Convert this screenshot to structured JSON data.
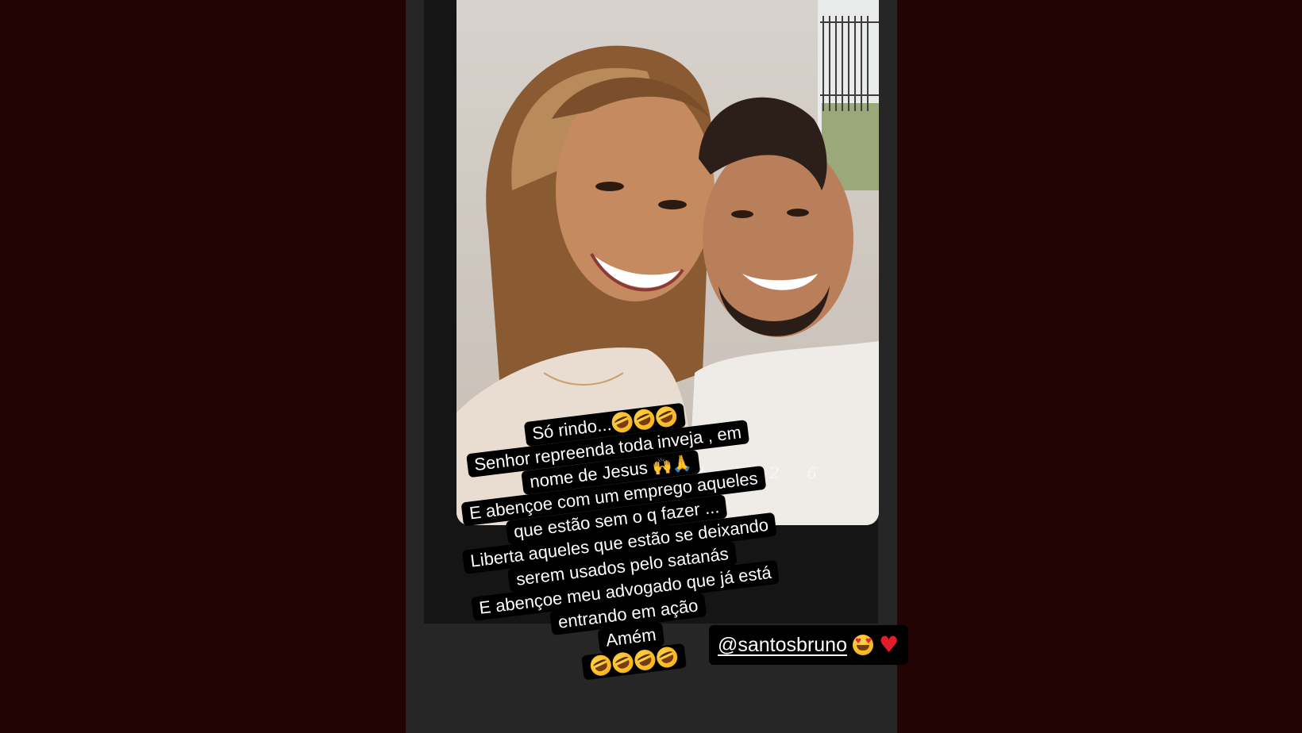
{
  "story": {
    "caption_lines": [
      "Só rindo...",
      "Senhor repreenda toda inveja , em",
      "nome de Jesus",
      "E abençoe com um emprego aqueles",
      "que estão sem o q fazer ...",
      "Liberta aqueles que estão se deixando",
      "serem usados pelo satanás",
      "E abençoe meu advogado que já está",
      "entrando em ação",
      "Amém"
    ],
    "line1_emojis": [
      "rolling-laughing",
      "rolling-laughing",
      "rolling-laughing"
    ],
    "line3_emojis": [
      "raised-hands",
      "folded-hands"
    ],
    "last_line_emojis": [
      "rolling-laughing",
      "rolling-laughing",
      "rolling-laughing",
      "rolling-laughing"
    ],
    "photo_watermark": "2 0 2 6",
    "mention": {
      "handle": "@santosbruno",
      "emojis": [
        "heart-eyes",
        "red-heart"
      ]
    }
  },
  "colors": {
    "page_background": "#220405",
    "story_background": "#262626",
    "caption_background": "#000000",
    "caption_text": "#ffffff"
  }
}
